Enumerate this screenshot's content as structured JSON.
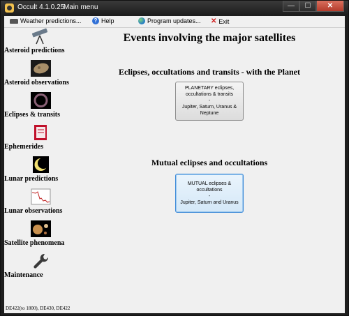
{
  "window": {
    "title": "Occult 4.1.0.25",
    "subtitle": "Main menu",
    "controls": {
      "minimize": "—",
      "maximize": "☐",
      "close": "✕"
    }
  },
  "menu": {
    "weather": "Weather predictions...",
    "help": "Help",
    "updates": "Program updates...",
    "exit": "Exit"
  },
  "sidebar": {
    "items": [
      {
        "label": "Asteroid predictions",
        "icon": "telescope-icon"
      },
      {
        "label": "Asteroid observations",
        "icon": "asteroid-icon"
      },
      {
        "label": "Eclipses & transits",
        "icon": "eclipse-icon"
      },
      {
        "label": "Ephemerides",
        "icon": "book-icon"
      },
      {
        "label": "Lunar predictions",
        "icon": "moon-icon"
      },
      {
        "label": "Lunar observations",
        "icon": "lightcurve-icon"
      },
      {
        "label": "Satellite phenomena",
        "icon": "planet-icon"
      },
      {
        "label": "Maintenance",
        "icon": "wrench-icon"
      }
    ]
  },
  "main": {
    "title": "Events involving the major satellites",
    "section1": {
      "title": "Eclipses, occultations and transits - with the Planet",
      "button": {
        "line1": "PLANETARY eclipses,",
        "line2": "occultations & transits",
        "sep": "-",
        "line3": "Jupiter, Saturn, Uranus &",
        "line4": "Neptune"
      }
    },
    "section2": {
      "title": "Mutual eclipses and occultations",
      "button": {
        "line1": "MUTUAL eclipses &",
        "line2": "occultations",
        "sep": "-",
        "line3": "Jupiter, Saturn and Uranus"
      }
    }
  },
  "status": "DE422(to 1800), DE430, DE422"
}
